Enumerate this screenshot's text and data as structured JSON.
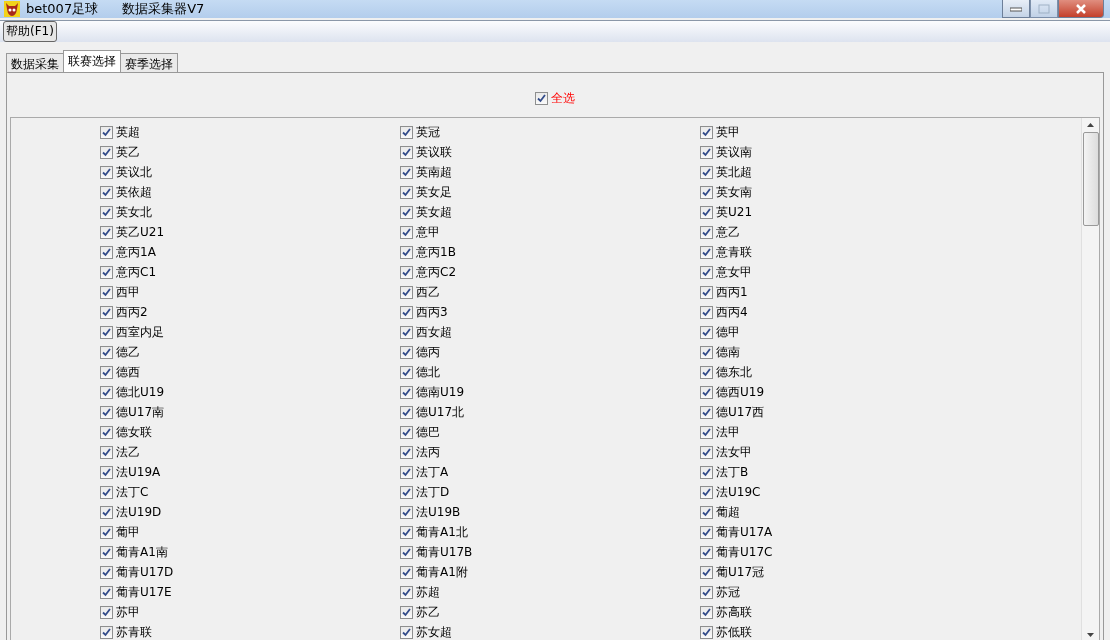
{
  "window": {
    "title": "bet007足球",
    "subtitle": "数据采集器V7"
  },
  "menu": [
    {
      "label": "帮助(F1)"
    }
  ],
  "tabs": [
    {
      "label": "数据采集",
      "selected": false
    },
    {
      "label": "联赛选择",
      "selected": true
    },
    {
      "label": "赛季选择",
      "selected": false
    }
  ],
  "select_all": {
    "label": "全选",
    "checked": true
  },
  "leagues": [
    {
      "label": "英超",
      "checked": true
    },
    {
      "label": "英冠",
      "checked": true
    },
    {
      "label": "英甲",
      "checked": true
    },
    {
      "label": "英乙",
      "checked": true
    },
    {
      "label": "英议联",
      "checked": true
    },
    {
      "label": "英议南",
      "checked": true
    },
    {
      "label": "英议北",
      "checked": true
    },
    {
      "label": "英南超",
      "checked": true
    },
    {
      "label": "英北超",
      "checked": true
    },
    {
      "label": "英依超",
      "checked": true
    },
    {
      "label": "英女足",
      "checked": true
    },
    {
      "label": "英女南",
      "checked": true
    },
    {
      "label": "英女北",
      "checked": true
    },
    {
      "label": "英女超",
      "checked": true
    },
    {
      "label": "英U21",
      "checked": true
    },
    {
      "label": "英乙U21",
      "checked": true
    },
    {
      "label": "意甲",
      "checked": true
    },
    {
      "label": "意乙",
      "checked": true
    },
    {
      "label": "意丙1A",
      "checked": true
    },
    {
      "label": "意丙1B",
      "checked": true
    },
    {
      "label": "意青联",
      "checked": true
    },
    {
      "label": "意丙C1",
      "checked": true
    },
    {
      "label": "意丙C2",
      "checked": true
    },
    {
      "label": "意女甲",
      "checked": true
    },
    {
      "label": "西甲",
      "checked": true
    },
    {
      "label": "西乙",
      "checked": true
    },
    {
      "label": "西丙1",
      "checked": true
    },
    {
      "label": "西丙2",
      "checked": true
    },
    {
      "label": "西丙3",
      "checked": true
    },
    {
      "label": "西丙4",
      "checked": true
    },
    {
      "label": "西室内足",
      "checked": true
    },
    {
      "label": "西女超",
      "checked": true
    },
    {
      "label": "德甲",
      "checked": true
    },
    {
      "label": "德乙",
      "checked": true
    },
    {
      "label": "德丙",
      "checked": true
    },
    {
      "label": "德南",
      "checked": true
    },
    {
      "label": "德西",
      "checked": true
    },
    {
      "label": "德北",
      "checked": true
    },
    {
      "label": "德东北",
      "checked": true
    },
    {
      "label": "德北U19",
      "checked": true
    },
    {
      "label": "德南U19",
      "checked": true
    },
    {
      "label": "德西U19",
      "checked": true
    },
    {
      "label": "德U17南",
      "checked": true
    },
    {
      "label": "德U17北",
      "checked": true
    },
    {
      "label": "德U17西",
      "checked": true
    },
    {
      "label": "德女联",
      "checked": true
    },
    {
      "label": "德巴",
      "checked": true
    },
    {
      "label": "法甲",
      "checked": true
    },
    {
      "label": "法乙",
      "checked": true
    },
    {
      "label": "法丙",
      "checked": true
    },
    {
      "label": "法女甲",
      "checked": true
    },
    {
      "label": "法U19A",
      "checked": true
    },
    {
      "label": "法丁A",
      "checked": true
    },
    {
      "label": "法丁B",
      "checked": true
    },
    {
      "label": "法丁C",
      "checked": true
    },
    {
      "label": "法丁D",
      "checked": true
    },
    {
      "label": "法U19C",
      "checked": true
    },
    {
      "label": "法U19D",
      "checked": true
    },
    {
      "label": "法U19B",
      "checked": true
    },
    {
      "label": "葡超",
      "checked": true
    },
    {
      "label": "葡甲",
      "checked": true
    },
    {
      "label": "葡青A1北",
      "checked": true
    },
    {
      "label": "葡青U17A",
      "checked": true
    },
    {
      "label": "葡青A1南",
      "checked": true
    },
    {
      "label": "葡青U17B",
      "checked": true
    },
    {
      "label": "葡青U17C",
      "checked": true
    },
    {
      "label": "葡青U17D",
      "checked": true
    },
    {
      "label": "葡青A1附",
      "checked": true
    },
    {
      "label": "葡U17冠",
      "checked": true
    },
    {
      "label": "葡青U17E",
      "checked": true
    },
    {
      "label": "苏超",
      "checked": true
    },
    {
      "label": "苏冠",
      "checked": true
    },
    {
      "label": "苏甲",
      "checked": true
    },
    {
      "label": "苏乙",
      "checked": true
    },
    {
      "label": "苏高联",
      "checked": true
    },
    {
      "label": "苏青联",
      "checked": true
    },
    {
      "label": "苏女超",
      "checked": true
    },
    {
      "label": "苏低联",
      "checked": true
    }
  ]
}
